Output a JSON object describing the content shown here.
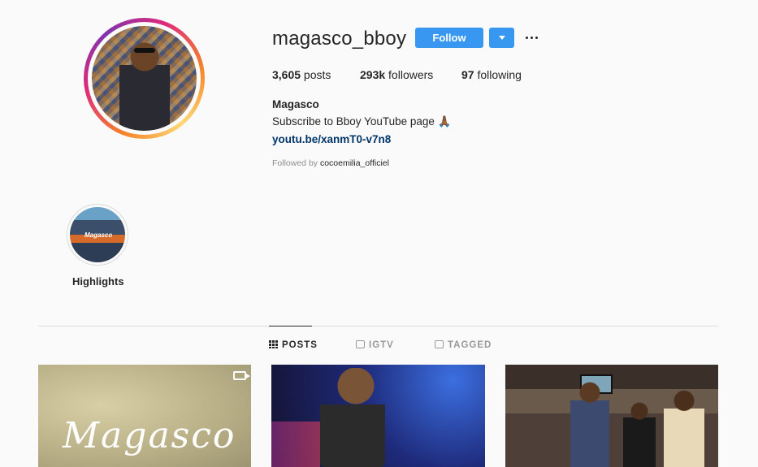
{
  "profile": {
    "username": "magasco_bboy",
    "follow_label": "Follow",
    "stats": {
      "posts_count": "3,605",
      "posts_label": " posts",
      "followers_count": "293k",
      "followers_label": " followers",
      "following_count": "97",
      "following_label": " following"
    },
    "full_name": "Magasco",
    "bio": "Subscribe to Bboy YouTube page 🙏🏾",
    "link": "youtu.be/xanmT0-v7n8",
    "followed_by_prefix": "Followed by ",
    "followed_by_user": "cocoemilia_officiel"
  },
  "highlights": [
    {
      "label": "Highlights",
      "thumb_text": "Magasco"
    }
  ],
  "tabs": [
    {
      "label": "POSTS",
      "icon": "grid-icon",
      "active": true
    },
    {
      "label": "IGTV",
      "icon": "tv-icon",
      "active": false
    },
    {
      "label": "TAGGED",
      "icon": "tag-icon",
      "active": false
    }
  ],
  "posts": [
    {
      "overlay_text": "Magasco",
      "icon": "video-icon"
    },
    {
      "overlay_text": ""
    },
    {
      "overlay_text": ""
    }
  ],
  "colors": {
    "accent": "#3897f0",
    "link": "#003569",
    "muted": "#8e8e8e",
    "background": "#fafafa"
  }
}
